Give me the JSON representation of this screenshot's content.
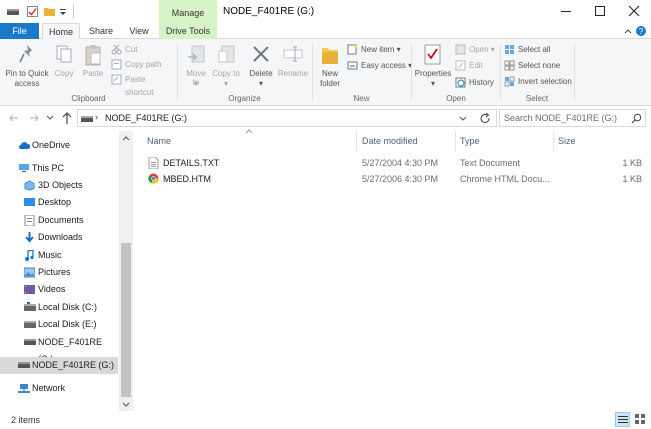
{
  "window": {
    "title": "NODE_F401RE (G:)",
    "contextual_tab_group": "Manage"
  },
  "tabs": {
    "file": "File",
    "home": "Home",
    "share": "Share",
    "view": "View",
    "drive_tools": "Drive Tools"
  },
  "ribbon": {
    "clipboard": {
      "group": "Clipboard",
      "pin": "Pin to Quick access",
      "copy": "Copy",
      "paste": "Paste",
      "cut": "Cut",
      "copy_path": "Copy path",
      "paste_shortcut": "Paste shortcut"
    },
    "organize": {
      "group": "Organize",
      "move_to": "Move to",
      "copy_to": "Copy to",
      "delete": "Delete",
      "rename": "Rename"
    },
    "new": {
      "group": "New",
      "new_folder": "New folder",
      "new_item": "New item",
      "easy_access": "Easy access"
    },
    "open": {
      "group": "Open",
      "properties": "Properties",
      "open": "Open",
      "edit": "Edit",
      "history": "History"
    },
    "select": {
      "group": "Select",
      "select_all": "Select all",
      "select_none": "Select none",
      "invert_selection": "Invert selection"
    }
  },
  "address": {
    "path": "NODE_F401RE (G:)",
    "search_placeholder": "Search NODE_F401RE (G:)"
  },
  "nav": {
    "items": [
      {
        "label": "OneDrive",
        "icon": "cloud-icon"
      },
      {
        "label": "This PC",
        "icon": "computer-icon"
      },
      {
        "label": "3D Objects",
        "icon": "cube-icon"
      },
      {
        "label": "Desktop",
        "icon": "desktop-icon"
      },
      {
        "label": "Documents",
        "icon": "documents-icon"
      },
      {
        "label": "Downloads",
        "icon": "download-arrow-icon"
      },
      {
        "label": "Music",
        "icon": "music-note-icon"
      },
      {
        "label": "Pictures",
        "icon": "pictures-icon"
      },
      {
        "label": "Videos",
        "icon": "video-icon"
      },
      {
        "label": "Local Disk (C:)",
        "icon": "drive-icon"
      },
      {
        "label": "Local Disk (E:)",
        "icon": "drive-icon"
      },
      {
        "label": "NODE_F401RE (G:)",
        "icon": "usb-drive-icon"
      },
      {
        "label": "NODE_F401RE (G:)",
        "icon": "usb-drive-icon",
        "selected": true
      },
      {
        "label": "Network",
        "icon": "network-icon"
      }
    ]
  },
  "columns": {
    "name": "Name",
    "date": "Date modified",
    "type": "Type",
    "size": "Size"
  },
  "files": [
    {
      "name": "DETAILS.TXT",
      "date": "5/27/2004 4:30 PM",
      "type": "Text Document",
      "size": "1 KB",
      "icon": "text-file-icon"
    },
    {
      "name": "MBED.HTM",
      "date": "5/27/2006 4:30 PM",
      "type": "Chrome HTML Docu...",
      "size": "1 KB",
      "icon": "chrome-icon"
    }
  ],
  "status": {
    "item_count": "2 items"
  },
  "colors": {
    "accent": "#1979ca",
    "contextual": "#d7f3c8",
    "selected_nav": "#d9d9d9"
  }
}
